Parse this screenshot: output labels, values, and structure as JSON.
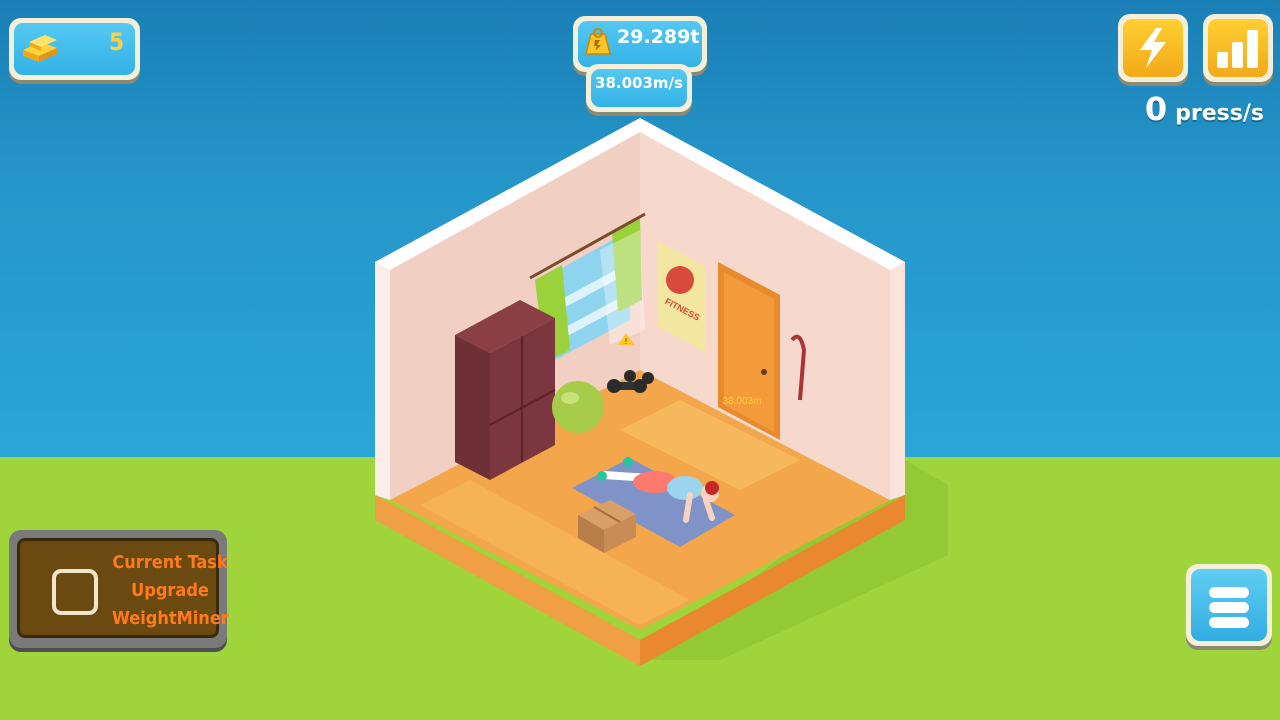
{
  "hud": {
    "gold_count": "5",
    "total_weight": "29.289t",
    "speed": "38.003m/s",
    "press_rate_value": "0",
    "press_rate_unit": "press/s"
  },
  "scene": {
    "poster_text": "FITNESS",
    "floor_label": "38.003m"
  },
  "task": {
    "lines": [
      "Current Task",
      "Upgrade",
      "WeightMiner"
    ]
  },
  "icons": {
    "gold": "gold-bars-icon",
    "weight": "weight-icon",
    "boost": "lightning-icon",
    "stats": "bar-chart-icon",
    "menu": "menu-icon",
    "checkbox": "checkbox-icon"
  },
  "colors": {
    "sky": "#2596c9",
    "grass": "#9fd53a",
    "gold_text": "#ffd23c",
    "task_text": "#ff7a1a"
  }
}
